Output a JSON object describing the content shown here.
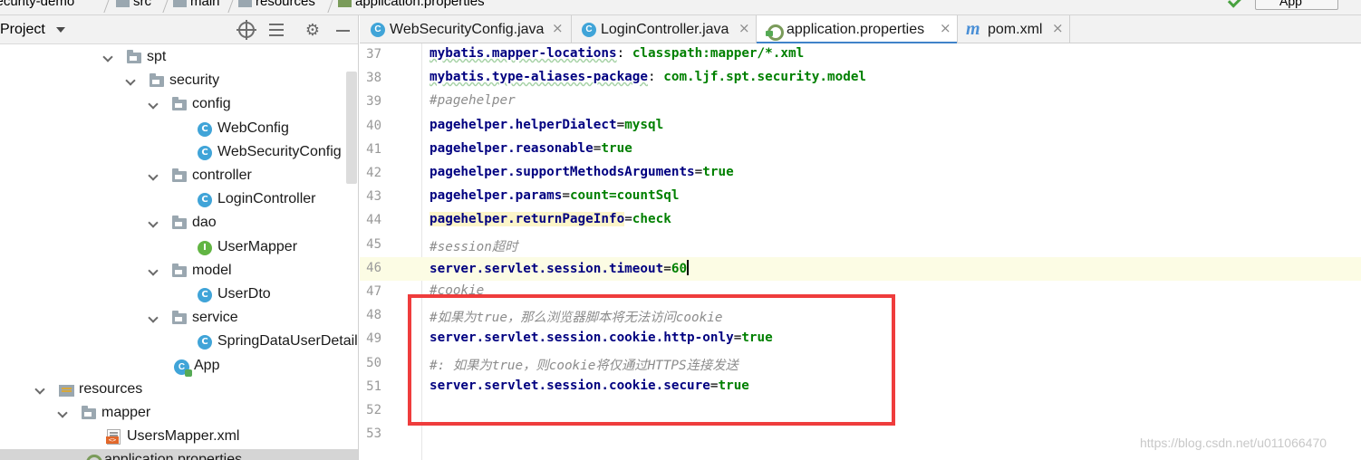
{
  "breadcrumb": {
    "items": [
      "security-demo",
      "src",
      "main",
      "resources",
      "application.properties"
    ]
  },
  "run_config": {
    "label": "App"
  },
  "project_panel": {
    "title": "Project",
    "tree": [
      {
        "label": "spt",
        "kind": "package",
        "expanded": true,
        "selected": false
      },
      {
        "label": "security",
        "kind": "package",
        "expanded": true,
        "selected": false
      },
      {
        "label": "config",
        "kind": "package",
        "expanded": true,
        "selected": false
      },
      {
        "label": "WebConfig",
        "kind": "class",
        "icon_letter": "C",
        "selected": false
      },
      {
        "label": "WebSecurityConfig",
        "kind": "class",
        "icon_letter": "C",
        "selected": false
      },
      {
        "label": "controller",
        "kind": "package",
        "expanded": true,
        "selected": false
      },
      {
        "label": "LoginController",
        "kind": "class",
        "icon_letter": "C",
        "selected": false
      },
      {
        "label": "dao",
        "kind": "package",
        "expanded": true,
        "selected": false
      },
      {
        "label": "UserMapper",
        "kind": "interface",
        "icon_letter": "I",
        "selected": false
      },
      {
        "label": "model",
        "kind": "package",
        "expanded": true,
        "selected": false
      },
      {
        "label": "UserDto",
        "kind": "class",
        "icon_letter": "C",
        "selected": false
      },
      {
        "label": "service",
        "kind": "package",
        "expanded": true,
        "selected": false
      },
      {
        "label": "SpringDataUserDetail",
        "kind": "class",
        "icon_letter": "C",
        "selected": false
      },
      {
        "label": "App",
        "kind": "app",
        "icon_letter": "C",
        "selected": false
      },
      {
        "label": "resources",
        "kind": "resources",
        "expanded": true,
        "selected": false
      },
      {
        "label": "mapper",
        "kind": "package",
        "expanded": true,
        "selected": false
      },
      {
        "label": "UsersMapper.xml",
        "kind": "xml",
        "selected": false
      },
      {
        "label": "application.properties",
        "kind": "properties",
        "selected": true
      }
    ]
  },
  "tabs": [
    {
      "label": "WebSecurityConfig.java",
      "kind": "class",
      "active": false
    },
    {
      "label": "LoginController.java",
      "kind": "class",
      "active": false
    },
    {
      "label": "application.properties",
      "kind": "properties",
      "active": true
    },
    {
      "label": "pom.xml",
      "kind": "maven",
      "active": false
    }
  ],
  "editor": {
    "current_line": "46",
    "lines": [
      {
        "n": "37",
        "tokens": [
          {
            "t": "mybatis.mapper-locations",
            "c": "k sq"
          },
          {
            "t": ": ",
            "c": "o"
          },
          {
            "t": "classpath:mapper/*.xml",
            "c": "v"
          }
        ]
      },
      {
        "n": "38",
        "tokens": [
          {
            "t": "mybatis.type-aliases-package",
            "c": "k sq"
          },
          {
            "t": ": ",
            "c": "o"
          },
          {
            "t": "com.ljf.spt.security.model",
            "c": "v"
          }
        ]
      },
      {
        "n": "39",
        "tokens": [
          {
            "t": "#pagehelper",
            "c": "c"
          }
        ]
      },
      {
        "n": "40",
        "tokens": [
          {
            "t": "pagehelper.helperDialect",
            "c": "k"
          },
          {
            "t": "=",
            "c": "o"
          },
          {
            "t": "mysql",
            "c": "v"
          }
        ]
      },
      {
        "n": "41",
        "tokens": [
          {
            "t": "pagehelper.reasonable",
            "c": "k"
          },
          {
            "t": "=",
            "c": "o"
          },
          {
            "t": "true",
            "c": "v"
          }
        ]
      },
      {
        "n": "42",
        "tokens": [
          {
            "t": "pagehelper.supportMethodsArguments",
            "c": "k"
          },
          {
            "t": "=",
            "c": "o"
          },
          {
            "t": "true",
            "c": "v"
          }
        ]
      },
      {
        "n": "43",
        "tokens": [
          {
            "t": "pagehelper.params",
            "c": "k"
          },
          {
            "t": "=",
            "c": "o"
          },
          {
            "t": "count=countSql",
            "c": "v"
          }
        ]
      },
      {
        "n": "44",
        "tokens": [
          {
            "t": "pagehelper.returnPageInfo",
            "c": "k hl"
          },
          {
            "t": "=",
            "c": "o"
          },
          {
            "t": "check",
            "c": "v"
          }
        ]
      },
      {
        "n": "45",
        "tokens": [
          {
            "t": "#session超时",
            "c": "c"
          }
        ]
      },
      {
        "n": "46",
        "tokens": [
          {
            "t": "server.servlet.session.timeout",
            "c": "k"
          },
          {
            "t": "=",
            "c": "o"
          },
          {
            "t": "60",
            "c": "v"
          }
        ]
      },
      {
        "n": "47",
        "tokens": [
          {
            "t": "#cookie",
            "c": "c"
          }
        ]
      },
      {
        "n": "48",
        "tokens": [
          {
            "t": "#如果为true，那么浏览器脚本将无法访问cookie",
            "c": "c"
          }
        ]
      },
      {
        "n": "49",
        "tokens": [
          {
            "t": "server.servlet.session.cookie.http-only",
            "c": "k"
          },
          {
            "t": "=",
            "c": "o"
          },
          {
            "t": "true",
            "c": "v"
          }
        ]
      },
      {
        "n": "50",
        "tokens": [
          {
            "t": "#: 如果为true，则cookie将仅通过HTTPS连接发送",
            "c": "c"
          }
        ]
      },
      {
        "n": "51",
        "tokens": [
          {
            "t": "server.servlet.session.cookie.secure",
            "c": "k"
          },
          {
            "t": "=",
            "c": "o"
          },
          {
            "t": "true",
            "c": "v"
          }
        ]
      },
      {
        "n": "52",
        "tokens": []
      },
      {
        "n": "53",
        "tokens": []
      }
    ]
  },
  "annotation": {
    "color": "#ef3c3c"
  },
  "watermark": "https://blog.csdn.net/u011066470",
  "colors": {
    "key": "#000080",
    "value": "#008000",
    "comment": "#8c8c8c",
    "active_tab_underline": "#4083c9",
    "class_icon": "#40a4d8"
  }
}
